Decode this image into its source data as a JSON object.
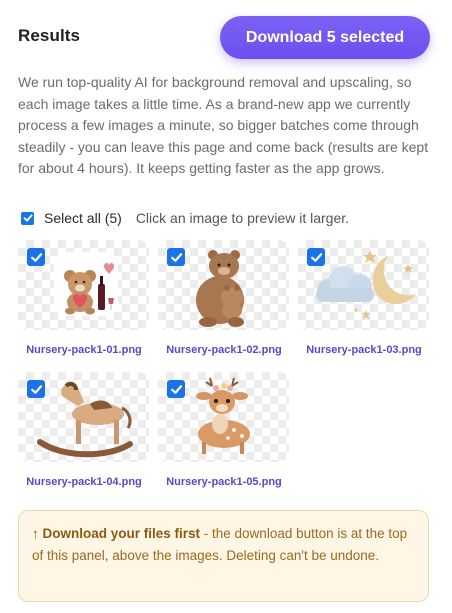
{
  "header": {
    "title": "Results",
    "download_button": "Download 5 selected"
  },
  "intro_text": "We run top-quality AI for background removal and upscaling, so each image takes a little time. As a brand-new app we currently process a few images a minute, so bigger batches come through steadily - you can leave this page and come back (results are kept for about 4 hours). It keeps getting faster as the app grows.",
  "selection": {
    "select_all_label": "Select all (5)",
    "select_all_checked": true,
    "hint": "Click an image to preview it larger."
  },
  "images": [
    {
      "filename": "Nursery-pack1-01.png",
      "checked": true,
      "icon": "teddy-bear-heart-wine-icon"
    },
    {
      "filename": "Nursery-pack1-02.png",
      "checked": true,
      "icon": "bear-mother-cub-icon"
    },
    {
      "filename": "Nursery-pack1-03.png",
      "checked": true,
      "icon": "cloud-moon-stars-icon"
    },
    {
      "filename": "Nursery-pack1-04.png",
      "checked": true,
      "icon": "rocking-horse-icon"
    },
    {
      "filename": "Nursery-pack1-05.png",
      "checked": true,
      "icon": "baby-deer-icon"
    }
  ],
  "notice": {
    "icon": "arrow-up",
    "strong": "↑ Download your files first",
    "text": " - the download button is at the top of this panel, above the images. Deleting can't be undone."
  },
  "colors": {
    "accent": "#6c4fef",
    "checkbox": "#1a73e8",
    "filename": "#5a48c8",
    "notice_bg": "#fff6e6",
    "notice_text": "#9a6a1e"
  }
}
